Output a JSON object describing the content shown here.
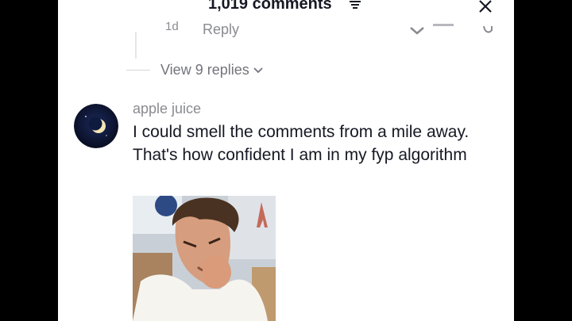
{
  "header": {
    "title": "1,019 comments"
  },
  "previous_reply": {
    "time_ago": "1d",
    "reply_label": "Reply"
  },
  "thread": {
    "view_replies_label": "View 9 replies"
  },
  "comment": {
    "username": "apple juice",
    "text": "I could smell the comments from a mile away. That's how confident I am in my fyp algorithm"
  },
  "icons": {
    "filter": "filter-icon",
    "close": "close-icon",
    "chevron": "chevron-down-icon",
    "avatar_moon": "crescent-moon-icon"
  }
}
